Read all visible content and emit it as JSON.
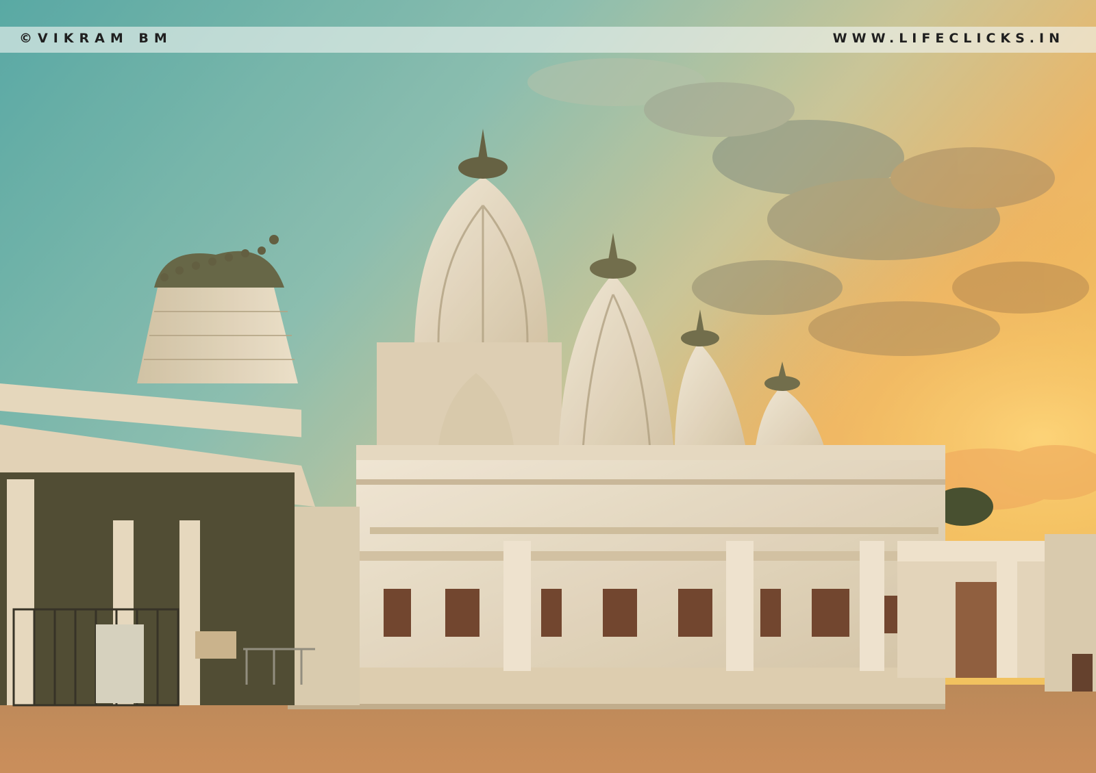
{
  "photo": {
    "subject": "",
    "watermark": {
      "left_text": "©VIKRAM BM",
      "right_text": "WWW.LIFECLICKS.IN"
    }
  },
  "colors": {
    "sky_top": "#5fb3b0",
    "sky_mid": "#9cc7b8",
    "sunset": "#f2b35a",
    "sunset_hot": "#f5c860",
    "temple_white": "#ece4d2",
    "temple_shadow": "#b9ac90",
    "ground": "#c88a5a"
  }
}
